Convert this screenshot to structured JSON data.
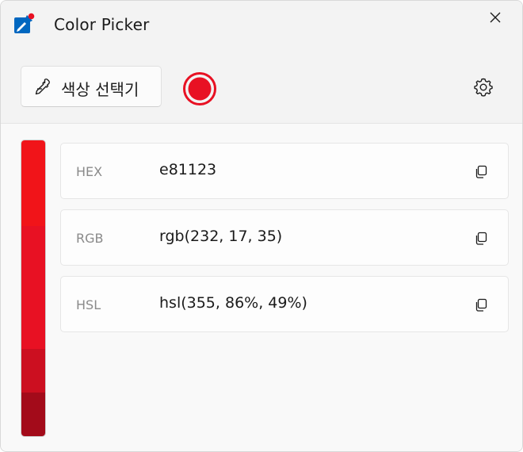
{
  "window": {
    "title": "Color Picker"
  },
  "toolbar": {
    "picker_label": "색상 선택기",
    "current_color": "#e81123"
  },
  "palette": {
    "swatches": [
      {
        "color": "#f11419",
        "weight": 108
      },
      {
        "color": "#e81123",
        "weight": 155
      },
      {
        "color": "#cc0f20",
        "weight": 55
      },
      {
        "color": "#a30b1a",
        "weight": 55
      }
    ]
  },
  "formats": [
    {
      "name": "HEX",
      "value": "e81123"
    },
    {
      "name": "RGB",
      "value": "rgb(232, 17, 35)"
    },
    {
      "name": "HSL",
      "value": "hsl(355, 86%, 49%)"
    }
  ],
  "icons": {
    "app": "color-picker-app-icon",
    "close": "close-icon",
    "eyedropper": "eyedropper-icon",
    "settings": "gear-icon",
    "copy": "copy-icon"
  },
  "colors": {
    "accent": "#0067c0",
    "selected": "#e81123"
  }
}
